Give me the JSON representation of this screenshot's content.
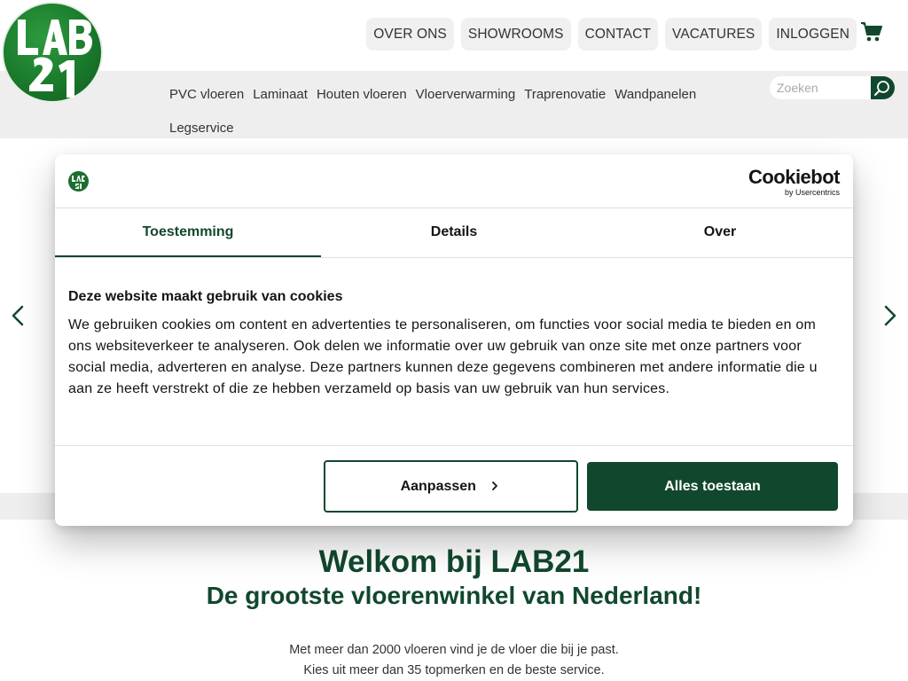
{
  "header": {
    "logo": {
      "alt": "LAB21"
    },
    "nav": [
      "OVER ONS",
      "SHOWROOMS",
      "CONTACT",
      "VACATURES",
      "INLOGGEN"
    ],
    "cart_icon": "cart-icon"
  },
  "categories": [
    "PVC vloeren",
    "Laminaat",
    "Houten vloeren",
    "Vloerverwarming",
    "Traprenovatie",
    "Wandpanelen",
    "Legservice"
  ],
  "search": {
    "placeholder": "Zoeken",
    "icon": "search-icon"
  },
  "cookie_dialog": {
    "brand": "Cookiebot",
    "brand_sub": "by Usercentrics",
    "tabs": [
      "Toestemming",
      "Details",
      "Over"
    ],
    "title": "Deze website maakt gebruik van cookies",
    "text": "We gebruiken cookies om content en advertenties te personaliseren, om functies voor social media te bieden en om ons websiteverkeer te analyseren. Ook delen we informatie over uw gebruik van onze site met onze partners voor social media, adverteren en analyse. Deze partners kunnen deze gegevens combineren met andere informatie die u aan ze heeft verstrekt of die ze hebben verzameld op basis van uw gebruik van hun services.",
    "customize_label": "Aanpassen",
    "allow_all_label": "Alles toestaan"
  },
  "welcome": {
    "title": "Welkom bij LAB21",
    "subtitle": "De grootste vloerenwinkel van Nederland!",
    "line1": "Met meer dan 2000 vloeren vind je de vloer die bij je past.",
    "line2": "Kies uit meer dan 35 topmerken en de beste service."
  },
  "colors": {
    "brand_green": "#11482d",
    "logo_green": "#1a7a2c",
    "bar_gray": "#eeeeee"
  }
}
